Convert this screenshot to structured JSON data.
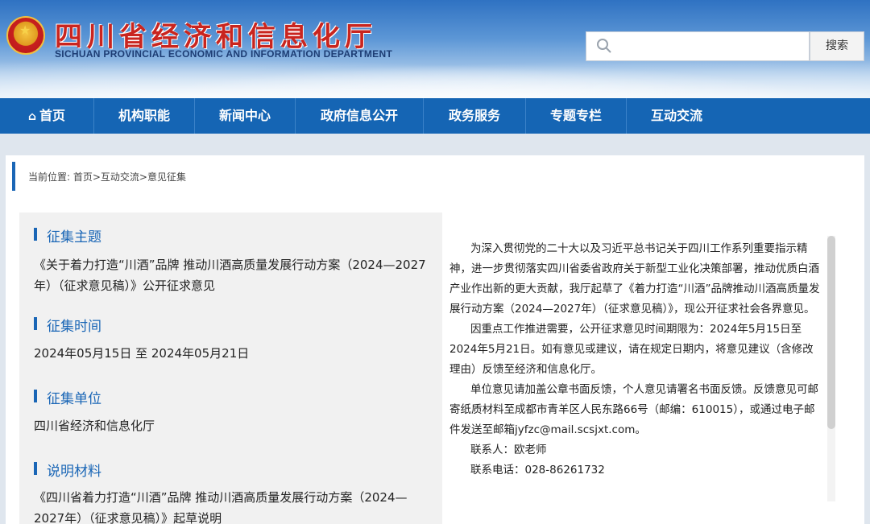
{
  "header": {
    "title": "四川省经济和信息化厅",
    "subtitle": "SICHUAN PROVINCIAL ECONOMIC AND INFORMATION DEPARTMENT",
    "search_placeholder": "",
    "search_button": "搜索"
  },
  "nav": {
    "items": [
      {
        "label": "首页",
        "icon": "home-icon"
      },
      {
        "label": "机构职能"
      },
      {
        "label": "新闻中心"
      },
      {
        "label": "政府信息公开"
      },
      {
        "label": "政务服务"
      },
      {
        "label": "专题专栏"
      },
      {
        "label": "互动交流"
      }
    ]
  },
  "breadcrumb": "当前位置: 首页>互动交流>意见征集",
  "sections": [
    {
      "title": "征集主题",
      "body": "《关于着力打造“川酒”品牌 推动川酒高质量发展行动方案（2024—2027年）（征求意见稿）》公开征求意见"
    },
    {
      "title": "征集时间",
      "body": "2024年05月15日 至 2024年05月21日"
    },
    {
      "title": "征集单位",
      "body": "四川省经济和信息化厅"
    },
    {
      "title": "说明材料",
      "body": "《四川省着力打造“川酒”品牌 推动川酒高质量发展行动方案（2024—2027年）（征求意见稿）》起草说明"
    }
  ],
  "content": {
    "paragraphs": [
      "为深入贯彻党的二十大以及习近平总书记关于四川工作系列重要指示精神，进一步贯彻落实四川省委省政府关于新型工业化决策部署，推动优质白酒产业作出新的更大贡献，我厅起草了《着力打造“川酒”品牌推动川酒高质量发展行动方案（2024—2027年）（征求意见稿）》，现公开征求社会各界意见。",
      "因重点工作推进需要，公开征求意见时间期限为：2024年5月15日至2024年5月21日。如有意见或建议，请在规定日期内，将意见建议（含修改理由）反馈至经济和信息化厅。",
      "单位意见请加盖公章书面反馈，个人意见请署名书面反馈。反馈意见可邮寄纸质材料至成都市青羊区人民东路66号（邮编：610015），或通过电子邮件发送至邮箱jyfzc@mail.scsjxt.com。",
      "联系人：欧老师",
      "联系电话：028-86261732"
    ]
  },
  "colors": {
    "nav_bg": "#1565b4",
    "accent": "#1a66b6",
    "title_red": "#c9251f"
  }
}
